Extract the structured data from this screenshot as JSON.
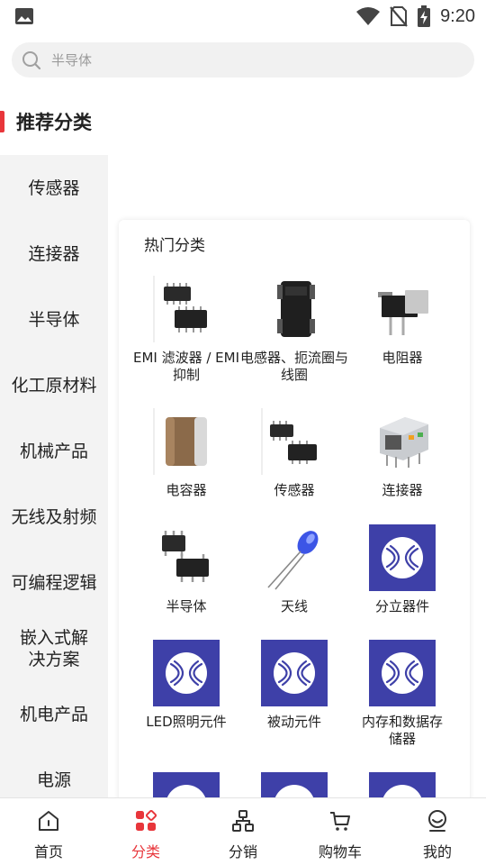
{
  "status_bar": {
    "time": "9:20",
    "icons": [
      "image-icon",
      "wifi-icon",
      "no-sim-icon",
      "battery-charging-icon"
    ]
  },
  "search": {
    "placeholder": "半导体",
    "icon": "search-icon"
  },
  "section": {
    "title": "推荐分类",
    "accent_color": "#e8363b"
  },
  "sidebar": {
    "items": [
      {
        "label": "传感器"
      },
      {
        "label": "连接器"
      },
      {
        "label": "半导体"
      },
      {
        "label": "化工原材料"
      },
      {
        "label": "机械产品"
      },
      {
        "label": "无线及射频"
      },
      {
        "label": "可编程逻辑"
      },
      {
        "label": "嵌入式解决方案"
      },
      {
        "label": "机电产品"
      },
      {
        "label": "电源"
      }
    ]
  },
  "hot": {
    "title": "热门分类",
    "items": [
      {
        "label": "EMI 滤波器 / EMI 抑制",
        "image": "emi-filter-chip-image"
      },
      {
        "label": "电感器、扼流圈与线圈",
        "image": "inductor-image"
      },
      {
        "label": "电阻器",
        "image": "resistor-image"
      },
      {
        "label": "电容器",
        "image": "capacitor-image"
      },
      {
        "label": "传感器",
        "image": "sensor-chip-image"
      },
      {
        "label": "连接器",
        "image": "rj45-connector-image"
      },
      {
        "label": "半导体",
        "image": "transistor-chip-image"
      },
      {
        "label": "天线",
        "image": "led-image"
      },
      {
        "label": "分立器件",
        "image": "brand-logo-tile"
      },
      {
        "label": "LED照明元件",
        "image": "brand-logo-tile"
      },
      {
        "label": "被动元件",
        "image": "brand-logo-tile"
      },
      {
        "label": "内存和数据存储器",
        "image": "brand-logo-tile"
      },
      {
        "label": "",
        "image": "brand-logo-tile"
      },
      {
        "label": "",
        "image": "brand-logo-tile"
      },
      {
        "label": "",
        "image": "brand-logo-tile"
      }
    ],
    "brand_tile_color": "#3e40a8"
  },
  "bottom_nav": {
    "active_color": "#e8363b",
    "items": [
      {
        "label": "首页",
        "icon": "home-icon"
      },
      {
        "label": "分类",
        "icon": "category-icon"
      },
      {
        "label": "分销",
        "icon": "distribution-icon"
      },
      {
        "label": "购物车",
        "icon": "cart-icon"
      },
      {
        "label": "我的",
        "icon": "profile-icon"
      }
    ]
  }
}
